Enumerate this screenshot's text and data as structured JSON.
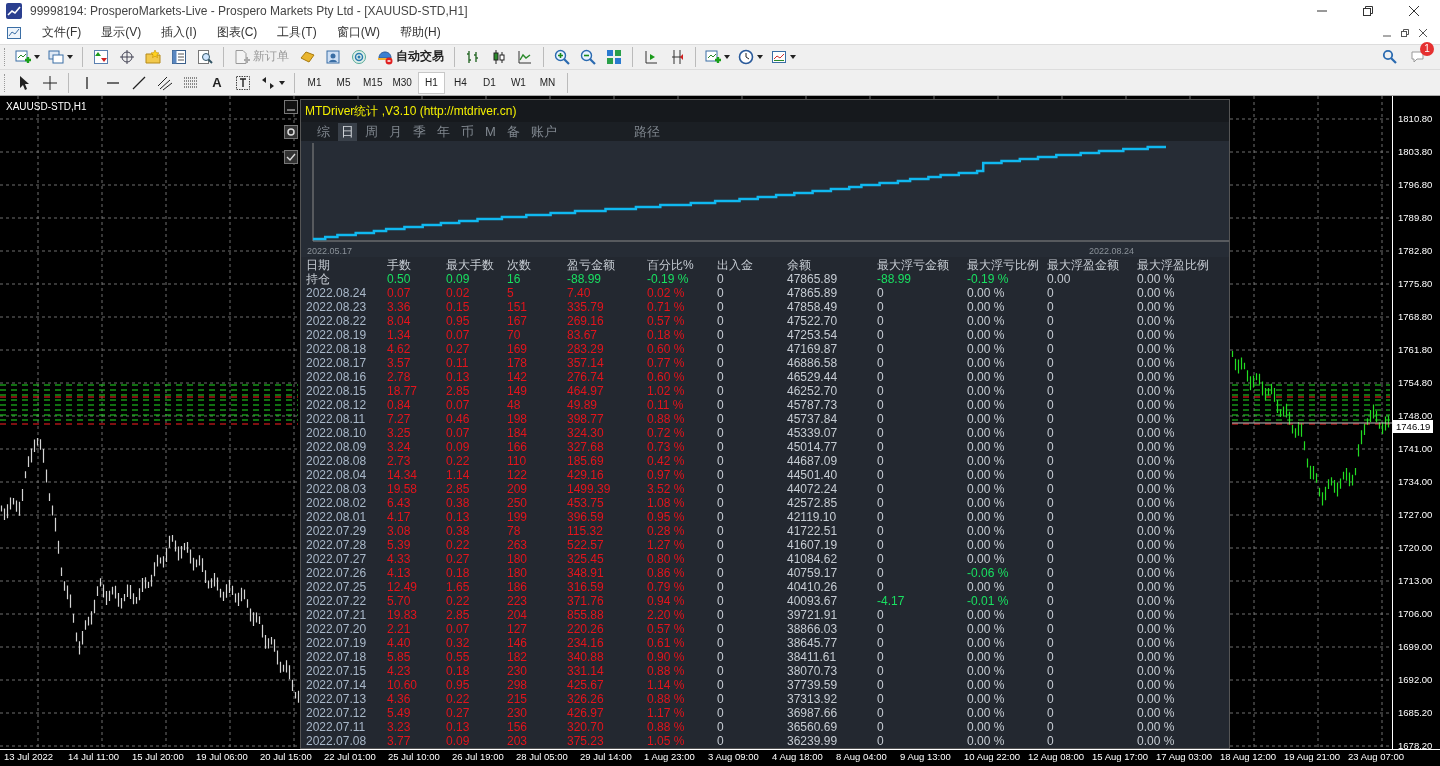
{
  "window": {
    "title": "99998194: ProsperoMarkets-Live - Prospero Markets Pty Ltd - [XAUUSD-STD,H1]"
  },
  "menu": [
    "文件(F)",
    "显示(V)",
    "插入(I)",
    "图表(C)",
    "工具(T)",
    "窗口(W)",
    "帮助(H)"
  ],
  "toolbar": {
    "new_order": {
      "label": "新订单",
      "disabled": true
    },
    "auto_trading": {
      "label": "自动交易"
    }
  },
  "notifications": {
    "badge": "1"
  },
  "drawing_tools": {
    "text_tool": "A"
  },
  "timeframes": [
    {
      "label": "M1",
      "selected": false
    },
    {
      "label": "M5",
      "selected": false
    },
    {
      "label": "M15",
      "selected": false
    },
    {
      "label": "M30",
      "selected": false
    },
    {
      "label": "H1",
      "selected": true
    },
    {
      "label": "H4",
      "selected": false
    },
    {
      "label": "D1",
      "selected": false
    },
    {
      "label": "W1",
      "selected": false
    },
    {
      "label": "MN",
      "selected": false
    }
  ],
  "chart": {
    "symbol": "XAUUSD-STD,H1",
    "current_price": "1746.19",
    "price_labels": [
      "1810.80",
      "1803.80",
      "1796.80",
      "1789.80",
      "1782.80",
      "1775.80",
      "1768.80",
      "1761.80",
      "1754.80",
      "1748.00",
      "1741.00",
      "1734.00",
      "1727.00",
      "1720.00",
      "1713.00",
      "1706.00",
      "1699.00",
      "1692.00",
      "1685.20",
      "1678.20"
    ],
    "time_labels": [
      "13 Jul 2022",
      "14 Jul 11:00",
      "15 Jul 20:00",
      "19 Jul 06:00",
      "20 Jul 15:00",
      "22 Jul 01:00",
      "25 Jul 10:00",
      "26 Jul 19:00",
      "28 Jul 05:00",
      "29 Jul 14:00",
      "1 Aug 23:00",
      "3 Aug 09:00",
      "4 Aug 18:00",
      "8 Aug 04:00",
      "9 Aug 13:00",
      "10 Aug 22:00",
      "12 Aug 08:00",
      "15 Aug 17:00",
      "17 Aug 03:00",
      "18 Aug 12:00",
      "19 Aug 21:00",
      "23 Aug 07:00"
    ]
  },
  "panel": {
    "title": "MTDriver统计 ,V3.10 (http://mtdriver.cn)",
    "tabs": [
      {
        "label": "综",
        "selected": false
      },
      {
        "label": "日",
        "selected": true
      },
      {
        "label": "周",
        "selected": false
      },
      {
        "label": "月",
        "selected": false
      },
      {
        "label": "季",
        "selected": false
      },
      {
        "label": "年",
        "selected": false
      },
      {
        "label": "币",
        "selected": false
      },
      {
        "label": "M",
        "selected": false
      },
      {
        "label": "备",
        "selected": false
      },
      {
        "label": "账户",
        "selected": false
      },
      {
        "label": "路径",
        "selected": false
      }
    ],
    "equity_chart": {
      "start_date": "2022.05.17",
      "end_date": "2022.08.24"
    },
    "table": {
      "columns": [
        "日期",
        "手数",
        "最大手数",
        "次数",
        "盈亏金额",
        "百分比%",
        "出入金",
        "余额",
        "最大浮亏金额",
        "最大浮亏比例",
        "最大浮盈金额",
        "最大浮盈比例"
      ],
      "rows": [
        {
          "kind": "position",
          "cells": [
            "持仓",
            {
              "text": "0.50",
              "alert": true
            },
            {
              "text": "0.09",
              "alert": true
            },
            {
              "text": "16",
              "alert": true
            },
            {
              "text": "-88.99",
              "alert": true
            },
            {
              "text": "-0.19 %",
              "alert": true
            },
            "0",
            "47865.89",
            {
              "text": "-88.99",
              "alert": true
            },
            {
              "text": "-0.19 %",
              "alert": true
            },
            "0.00",
            "0.00 %"
          ]
        },
        {
          "kind": "day",
          "cells": [
            "2022.08.24",
            "0.07",
            "0.02",
            "5",
            "7.40",
            "0.02 %",
            "0",
            "47865.89",
            "0",
            "0.00 %",
            "0",
            "0.00 %"
          ]
        },
        {
          "kind": "day",
          "cells": [
            "2022.08.23",
            "3.36",
            "0.15",
            "151",
            "335.79",
            "0.71 %",
            "0",
            "47858.49",
            "0",
            "0.00 %",
            "0",
            "0.00 %"
          ]
        },
        {
          "kind": "day",
          "cells": [
            "2022.08.22",
            "8.04",
            "0.95",
            "167",
            "269.16",
            "0.57 %",
            "0",
            "47522.70",
            "0",
            "0.00 %",
            "0",
            "0.00 %"
          ]
        },
        {
          "kind": "day",
          "cells": [
            "2022.08.19",
            "1.34",
            "0.07",
            "70",
            "83.67",
            "0.18 %",
            "0",
            "47253.54",
            "0",
            "0.00 %",
            "0",
            "0.00 %"
          ]
        },
        {
          "kind": "day",
          "cells": [
            "2022.08.18",
            "4.62",
            "0.27",
            "169",
            "283.29",
            "0.60 %",
            "0",
            "47169.87",
            "0",
            "0.00 %",
            "0",
            "0.00 %"
          ]
        },
        {
          "kind": "day",
          "cells": [
            "2022.08.17",
            "3.57",
            "0.11",
            "178",
            "357.14",
            "0.77 %",
            "0",
            "46886.58",
            "0",
            "0.00 %",
            "0",
            "0.00 %"
          ]
        },
        {
          "kind": "day",
          "cells": [
            "2022.08.16",
            "2.78",
            "0.13",
            "142",
            "276.74",
            "0.60 %",
            "0",
            "46529.44",
            "0",
            "0.00 %",
            "0",
            "0.00 %"
          ]
        },
        {
          "kind": "day",
          "cells": [
            "2022.08.15",
            "18.77",
            "2.85",
            "149",
            "464.97",
            "1.02 %",
            "0",
            "46252.70",
            "0",
            "0.00 %",
            "0",
            "0.00 %"
          ]
        },
        {
          "kind": "day",
          "cells": [
            "2022.08.12",
            "0.84",
            "0.07",
            "48",
            "49.89",
            "0.11 %",
            "0",
            "45787.73",
            "0",
            "0.00 %",
            "0",
            "0.00 %"
          ]
        },
        {
          "kind": "day",
          "cells": [
            "2022.08.11",
            "7.27",
            "0.46",
            "198",
            "398.77",
            "0.88 %",
            "0",
            "45737.84",
            "0",
            "0.00 %",
            "0",
            "0.00 %"
          ]
        },
        {
          "kind": "day",
          "cells": [
            "2022.08.10",
            "3.25",
            "0.07",
            "184",
            "324.30",
            "0.72 %",
            "0",
            "45339.07",
            "0",
            "0.00 %",
            "0",
            "0.00 %"
          ]
        },
        {
          "kind": "day",
          "cells": [
            "2022.08.09",
            "3.24",
            "0.09",
            "166",
            "327.68",
            "0.73 %",
            "0",
            "45014.77",
            "0",
            "0.00 %",
            "0",
            "0.00 %"
          ]
        },
        {
          "kind": "day",
          "cells": [
            "2022.08.08",
            "2.73",
            "0.22",
            "110",
            "185.69",
            "0.42 %",
            "0",
            "44687.09",
            "0",
            "0.00 %",
            "0",
            "0.00 %"
          ]
        },
        {
          "kind": "day",
          "cells": [
            "2022.08.04",
            "14.34",
            "1.14",
            "122",
            "429.16",
            "0.97 %",
            "0",
            "44501.40",
            "0",
            "0.00 %",
            "0",
            "0.00 %"
          ]
        },
        {
          "kind": "day",
          "cells": [
            "2022.08.03",
            "19.58",
            "2.85",
            "209",
            "1499.39",
            "3.52 %",
            "0",
            "44072.24",
            "0",
            "0.00 %",
            "0",
            "0.00 %"
          ]
        },
        {
          "kind": "day",
          "cells": [
            "2022.08.02",
            "6.43",
            "0.38",
            "250",
            "453.75",
            "1.08 %",
            "0",
            "42572.85",
            "0",
            "0.00 %",
            "0",
            "0.00 %"
          ]
        },
        {
          "kind": "day",
          "cells": [
            "2022.08.01",
            "4.17",
            "0.13",
            "199",
            "396.59",
            "0.95 %",
            "0",
            "42119.10",
            "0",
            "0.00 %",
            "0",
            "0.00 %"
          ]
        },
        {
          "kind": "day",
          "cells": [
            "2022.07.29",
            "3.08",
            "0.38",
            "78",
            "115.32",
            "0.28 %",
            "0",
            "41722.51",
            "0",
            "0.00 %",
            "0",
            "0.00 %"
          ]
        },
        {
          "kind": "day",
          "cells": [
            "2022.07.28",
            "5.39",
            "0.22",
            "263",
            "522.57",
            "1.27 %",
            "0",
            "41607.19",
            "0",
            "0.00 %",
            "0",
            "0.00 %"
          ]
        },
        {
          "kind": "day",
          "cells": [
            "2022.07.27",
            "4.33",
            "0.27",
            "180",
            "325.45",
            "0.80 %",
            "0",
            "41084.62",
            "0",
            "0.00 %",
            "0",
            "0.00 %"
          ]
        },
        {
          "kind": "day",
          "cells": [
            "2022.07.26",
            "4.13",
            "0.18",
            "180",
            "348.91",
            "0.86 %",
            "0",
            "40759.17",
            "0",
            {
              "text": "-0.06 %",
              "alert": true
            },
            "0",
            "0.00 %"
          ]
        },
        {
          "kind": "day",
          "cells": [
            "2022.07.25",
            "12.49",
            "1.65",
            "186",
            "316.59",
            "0.79 %",
            "0",
            "40410.26",
            "0",
            "0.00 %",
            "0",
            "0.00 %"
          ]
        },
        {
          "kind": "day",
          "cells": [
            "2022.07.22",
            "5.70",
            "0.22",
            "223",
            "371.76",
            "0.94 %",
            "0",
            "40093.67",
            {
              "text": "-4.17",
              "alert": true
            },
            {
              "text": "-0.01 %",
              "alert": true
            },
            "0",
            "0.00 %"
          ]
        },
        {
          "kind": "day",
          "cells": [
            "2022.07.21",
            "19.83",
            "2.85",
            "204",
            "855.88",
            "2.20 %",
            "0",
            "39721.91",
            "0",
            "0.00 %",
            "0",
            "0.00 %"
          ]
        },
        {
          "kind": "day",
          "cells": [
            "2022.07.20",
            "2.21",
            "0.07",
            "127",
            "220.26",
            "0.57 %",
            "0",
            "38866.03",
            "0",
            "0.00 %",
            "0",
            "0.00 %"
          ]
        },
        {
          "kind": "day",
          "cells": [
            "2022.07.19",
            "4.40",
            "0.32",
            "146",
            "234.16",
            "0.61 %",
            "0",
            "38645.77",
            "0",
            "0.00 %",
            "0",
            "0.00 %"
          ]
        },
        {
          "kind": "day",
          "cells": [
            "2022.07.18",
            "5.85",
            "0.55",
            "182",
            "340.88",
            "0.90 %",
            "0",
            "38411.61",
            "0",
            "0.00 %",
            "0",
            "0.00 %"
          ]
        },
        {
          "kind": "day",
          "cells": [
            "2022.07.15",
            "4.23",
            "0.18",
            "230",
            "331.14",
            "0.88 %",
            "0",
            "38070.73",
            "0",
            "0.00 %",
            "0",
            "0.00 %"
          ]
        },
        {
          "kind": "day",
          "cells": [
            "2022.07.14",
            "10.60",
            "0.95",
            "298",
            "425.67",
            "1.14 %",
            "0",
            "37739.59",
            "0",
            "0.00 %",
            "0",
            "0.00 %"
          ]
        },
        {
          "kind": "day",
          "cells": [
            "2022.07.13",
            "4.36",
            "0.22",
            "215",
            "326.26",
            "0.88 %",
            "0",
            "37313.92",
            "0",
            "0.00 %",
            "0",
            "0.00 %"
          ]
        },
        {
          "kind": "day",
          "cells": [
            "2022.07.12",
            "5.49",
            "0.27",
            "230",
            "426.97",
            "1.17 %",
            "0",
            "36987.66",
            "0",
            "0.00 %",
            "0",
            "0.00 %"
          ]
        },
        {
          "kind": "day",
          "cells": [
            "2022.07.11",
            "3.23",
            "0.13",
            "156",
            "320.70",
            "0.88 %",
            "0",
            "36560.69",
            "0",
            "0.00 %",
            "0",
            "0.00 %"
          ]
        },
        {
          "kind": "day",
          "cells": [
            "2022.07.08",
            "3.77",
            "0.09",
            "203",
            "375.23",
            "1.05 %",
            "0",
            "36239.99",
            "0",
            "0.00 %",
            "0",
            "0.00 %"
          ]
        }
      ]
    }
  }
}
